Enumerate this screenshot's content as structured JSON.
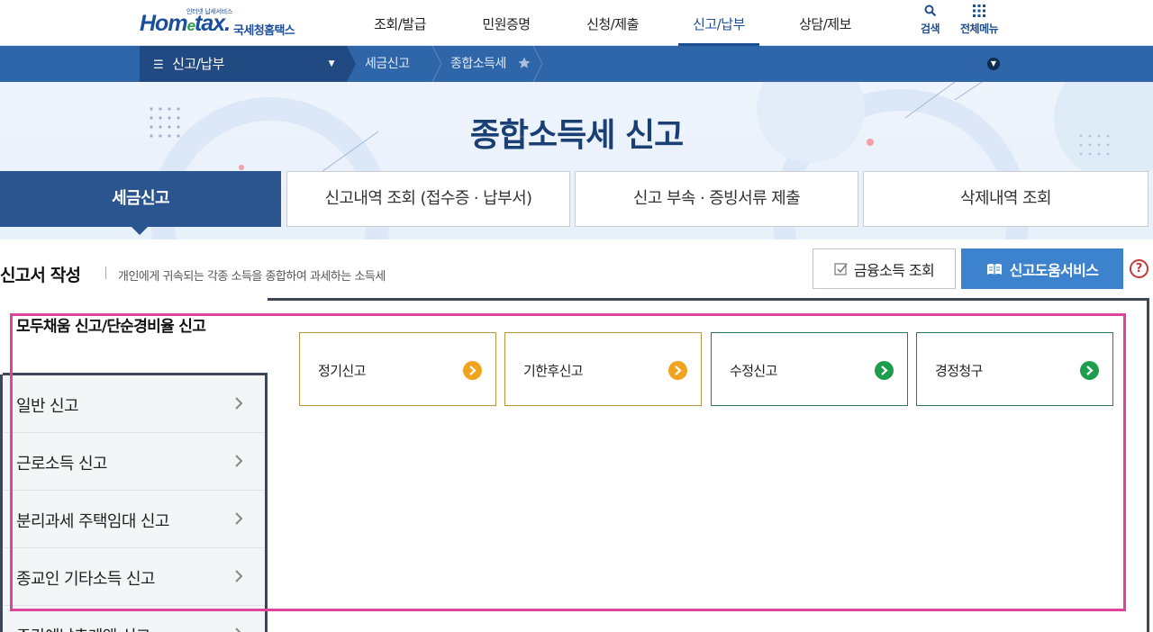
{
  "logo": {
    "tagline": "인터넷 납세서비스",
    "name_part1": "Hom",
    "name_e": "e",
    "name_part2": "tax.",
    "subtitle": "국세청홈택스"
  },
  "nav": {
    "items": [
      "조회/발급",
      "민원증명",
      "신청/제출",
      "신고/납부",
      "상담/제보"
    ],
    "active": "신고/납부",
    "search_label": "검색",
    "menu_label": "전체메뉴"
  },
  "breadcrumb": {
    "menu_label": "신고/납부",
    "level1": "세금신고",
    "level2": "종합소득세"
  },
  "page": {
    "title": "종합소득세 신고"
  },
  "tabs": [
    "세금신고",
    "신고내역 조회 (접수증 · 납부서)",
    "신고 부속 · 증빙서류 제출",
    "삭제내역 조회"
  ],
  "section": {
    "title": "신고서 작성",
    "description": "개인에게 귀속되는 각종 소득을 종합하여 과세하는 소득세",
    "btn_financial": "금융소득 조회",
    "btn_help": "신고도움서비스",
    "help_icon": "?"
  },
  "sidebar": {
    "active_label": "모두채움 신고/단순경비율 신고",
    "items": [
      "일반 신고",
      "근로소득 신고",
      "분리과세 주택임대 신고",
      "종교인 기타소득 신고",
      "주간예납추계액 신고"
    ]
  },
  "cards": [
    {
      "label": "정기신고",
      "accent": "#f1a21f"
    },
    {
      "label": "기한후신고",
      "accent": "#f1a21f"
    },
    {
      "label": "수정신고",
      "accent": "#1f9d4f"
    },
    {
      "label": "경정청구",
      "accent": "#1f9d4f"
    }
  ],
  "colors": {
    "brand": "#1d4f91",
    "nav_bar": "#2f66aa",
    "highlight": "#e0449a"
  }
}
